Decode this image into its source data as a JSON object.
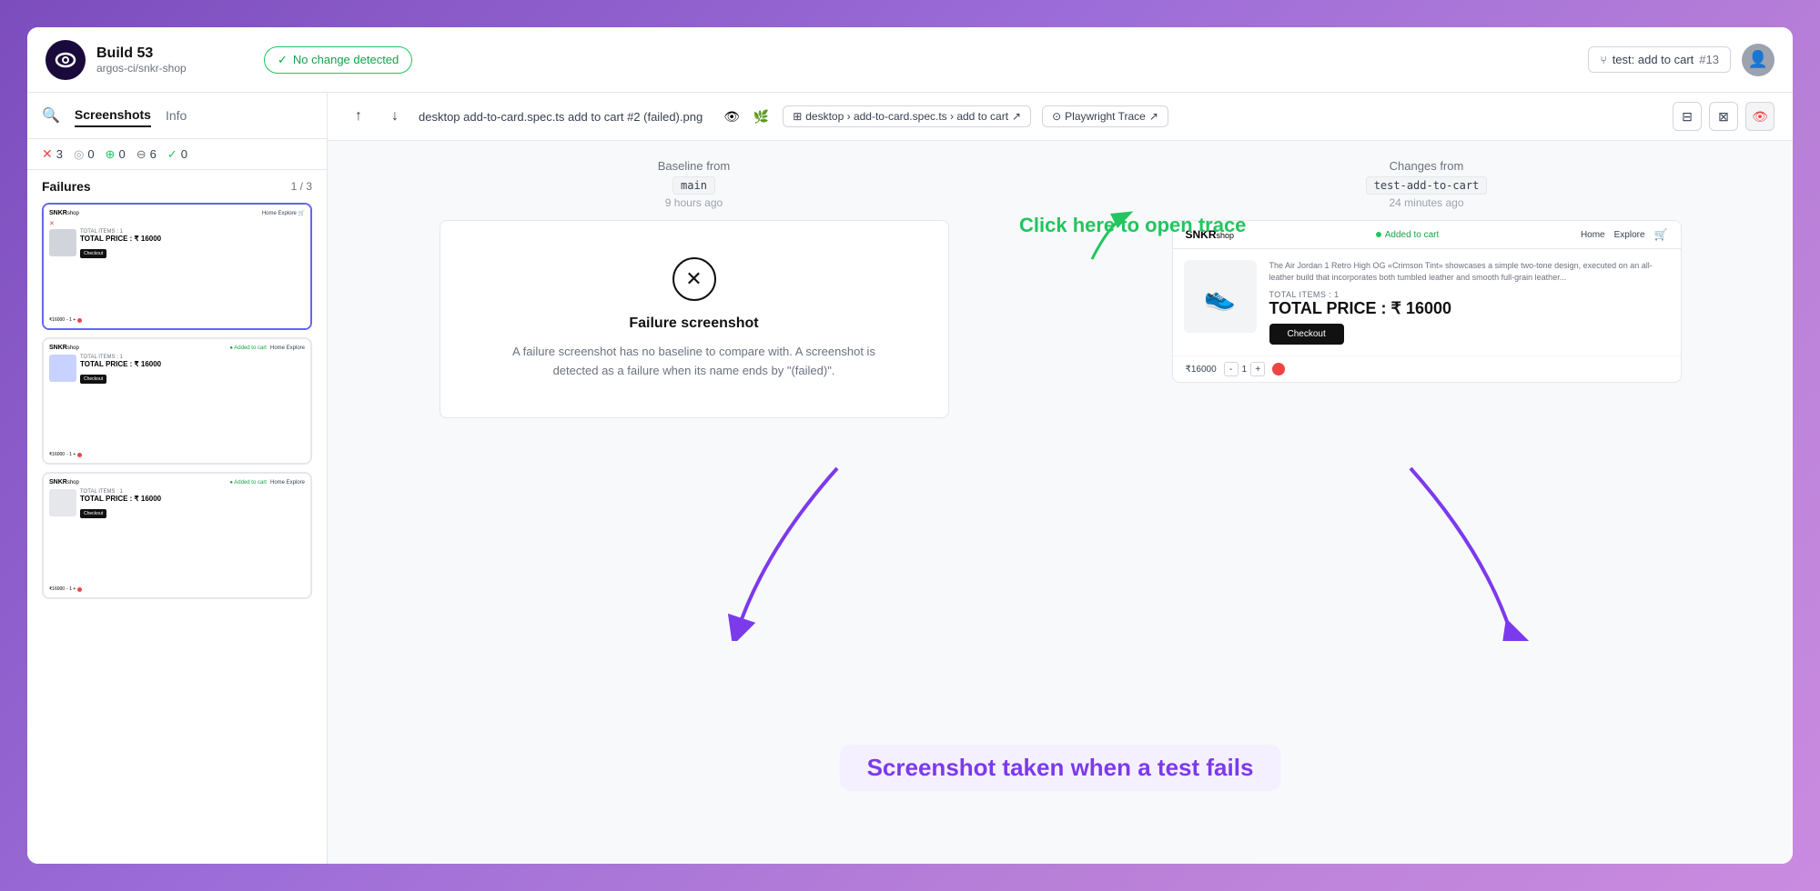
{
  "header": {
    "build_title": "Build 53",
    "build_subtitle": "argos-ci/snkr-shop",
    "status_label": "No change detected",
    "test_badge_label": "test: add to cart",
    "test_badge_number": "#13"
  },
  "sidebar": {
    "screenshots_tab": "Screenshots",
    "info_tab": "Info",
    "filters": [
      {
        "icon": "✕",
        "count": "3"
      },
      {
        "icon": "◎",
        "count": "0"
      },
      {
        "icon": "⊕",
        "count": "0"
      },
      {
        "icon": "⊖",
        "count": "6"
      },
      {
        "icon": "✓",
        "count": "0"
      }
    ],
    "failures_title": "Failures",
    "failures_pagination": "1 / 3"
  },
  "viewer": {
    "filename": "desktop add-to-card.spec.ts add to cart #2 (failed).png",
    "breadcrumb_text": "desktop › add-to-card.spec.ts › add to cart",
    "playwright_trace_text": "Playwright Trace",
    "baseline_label": "Baseline from",
    "baseline_branch": "main",
    "baseline_time": "9 hours ago",
    "changes_label": "Changes from",
    "changes_branch": "test-add-to-cart",
    "changes_time": "24 minutes ago"
  },
  "failure_card": {
    "title": "Failure screenshot",
    "description": "A failure screenshot has no baseline to compare with. A screenshot is detected as a failure when its name ends by \"(failed)\"."
  },
  "snkr_screenshot": {
    "logo": "SNKR",
    "logo_sub": "shop",
    "added_badge": "Added to cart",
    "nav_home": "Home",
    "nav_explore": "Explore",
    "product_desc": "The Air Jordan 1 Retro High OG &laquo;Crimson Tint&raquo; showcases a simple two-tone design, executed on an all-leather build that incorporates both tumbled leather and smooth full-grain leather...",
    "total_items_label": "TOTAL ITEMS : 1",
    "total_price_label": "TOTAL PRICE : ₹ 16000",
    "checkout_btn": "Checkout",
    "price": "₹16000"
  },
  "annotations": {
    "open_trace_text": "Click here to open trace",
    "screenshot_fail_text": "Screenshot taken when a test fails"
  },
  "thumbnails": [
    {
      "id": 1,
      "active": true,
      "price": "TOTAL PRICE : ₹ 16000"
    },
    {
      "id": 2,
      "active": false,
      "price": "TOTAL PRICE : ₹ 16000"
    },
    {
      "id": 3,
      "active": false,
      "price": "TOTAL PRICE : ₹ 16000"
    }
  ]
}
